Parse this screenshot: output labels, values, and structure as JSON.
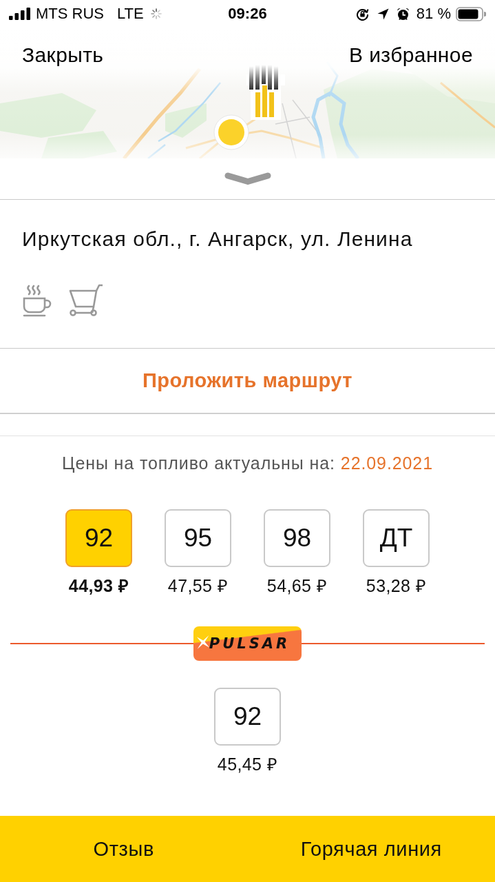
{
  "status_bar": {
    "carrier": "MTS RUS",
    "network": "LTE",
    "time": "09:26",
    "battery": "81 %"
  },
  "header": {
    "close": "Закрыть",
    "favorite": "В избранное"
  },
  "station": {
    "address": "Иркутская обл., г. Ангарск, ул. Ленина",
    "amenities": [
      {
        "kind": "cafe"
      },
      {
        "kind": "shop"
      }
    ]
  },
  "route_button": "Проложить маршрут",
  "prices": {
    "label": "Цены на топливо актуальны на:",
    "date": "22.09.2021",
    "fuels": [
      {
        "grade": "92",
        "price": "44,93 ₽",
        "selected": true
      },
      {
        "grade": "95",
        "price": "47,55 ₽",
        "selected": false
      },
      {
        "grade": "98",
        "price": "54,65 ₽",
        "selected": false
      },
      {
        "grade": "ДТ",
        "price": "53,28 ₽",
        "selected": false
      }
    ]
  },
  "partner": {
    "brand": "PULSAR",
    "fuels": [
      {
        "grade": "92",
        "price": "45,45 ₽",
        "selected": false
      }
    ]
  },
  "bottom_bar": {
    "buttons": [
      "Отзыв",
      "Горячая линия"
    ]
  }
}
